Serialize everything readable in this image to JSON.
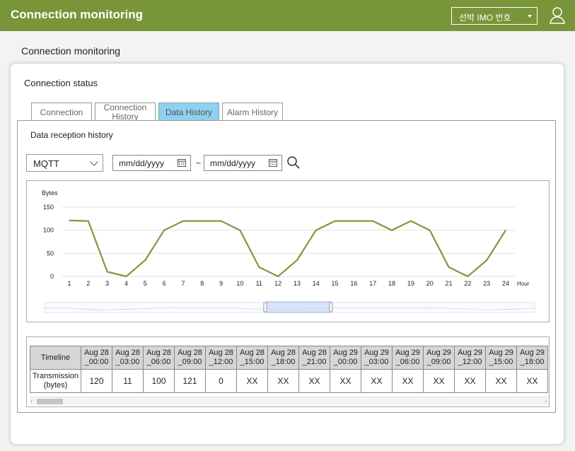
{
  "app": {
    "title": "Connection monitoring"
  },
  "header": {
    "vessel_select": "선박 IMO 번호",
    "user_icon": "user-icon"
  },
  "page": {
    "title": "Connection monitoring"
  },
  "section": {
    "title": "Connection status"
  },
  "tabs": [
    {
      "label": "Connection",
      "active": false
    },
    {
      "label": "Connection History",
      "line1": "Connection",
      "line2": "History",
      "active": false
    },
    {
      "label": "Data History",
      "active": true
    },
    {
      "label": "Alarm History",
      "active": false
    }
  ],
  "panel": {
    "title": "Data reception history",
    "protocol": "MQTT",
    "start_date": "mm/dd/yyyy",
    "separator": "~",
    "end_date": "mm/dd/yyyy"
  },
  "colors": {
    "accent": "#78953a",
    "active_tab": "#8fd0ef",
    "line": "#7f983f"
  },
  "chart_data": {
    "type": "line",
    "ylabel": "Bytes",
    "xlabel": "Hour",
    "ylim": [
      0,
      150
    ],
    "yticks": [
      "150",
      "100",
      "50",
      "0"
    ],
    "x": [
      "1",
      "2",
      "3",
      "4",
      "5",
      "6",
      "7",
      "8",
      "9",
      "10",
      "11",
      "12",
      "13",
      "14",
      "15",
      "16",
      "17",
      "18",
      "19",
      "20",
      "21",
      "22",
      "23",
      "24"
    ],
    "values": [
      121,
      120,
      10,
      0,
      35,
      100,
      120,
      120,
      120,
      100,
      20,
      0,
      35,
      100,
      120,
      120,
      120,
      100,
      120,
      100,
      20,
      0,
      35,
      100
    ],
    "grid": true,
    "has_range_slider": true
  },
  "table": {
    "row_header_1": "Timeline",
    "row_header_2_line1": "Transmission",
    "row_header_2_line2": "(bytes)",
    "columns": [
      {
        "date": "Aug 28",
        "time": "_00:00",
        "value": "120"
      },
      {
        "date": "Aug 28",
        "time": "_03:00",
        "value": "11"
      },
      {
        "date": "Aug 28",
        "time": "_06:00",
        "value": "100"
      },
      {
        "date": "Aug 28",
        "time": "_09:00",
        "value": "121"
      },
      {
        "date": "Aug 28",
        "time": "_12:00",
        "value": "0"
      },
      {
        "date": "Aug 28",
        "time": "_15:00",
        "value": "XX"
      },
      {
        "date": "Aug 28",
        "time": "_18:00",
        "value": "XX"
      },
      {
        "date": "Aug 28",
        "time": "_21:00",
        "value": "XX"
      },
      {
        "date": "Aug 29",
        "time": "_00:00",
        "value": "XX"
      },
      {
        "date": "Aug 29",
        "time": "_03:00",
        "value": "XX"
      },
      {
        "date": "Aug 29",
        "time": "_06:00",
        "value": "XX"
      },
      {
        "date": "Aug 29",
        "time": "_09:00",
        "value": "XX"
      },
      {
        "date": "Aug 29",
        "time": "_12:00",
        "value": "XX"
      },
      {
        "date": "Aug 29",
        "time": "_15:00",
        "value": "XX"
      },
      {
        "date": "Aug 29",
        "time": "_18:00",
        "value": "XX"
      }
    ]
  }
}
